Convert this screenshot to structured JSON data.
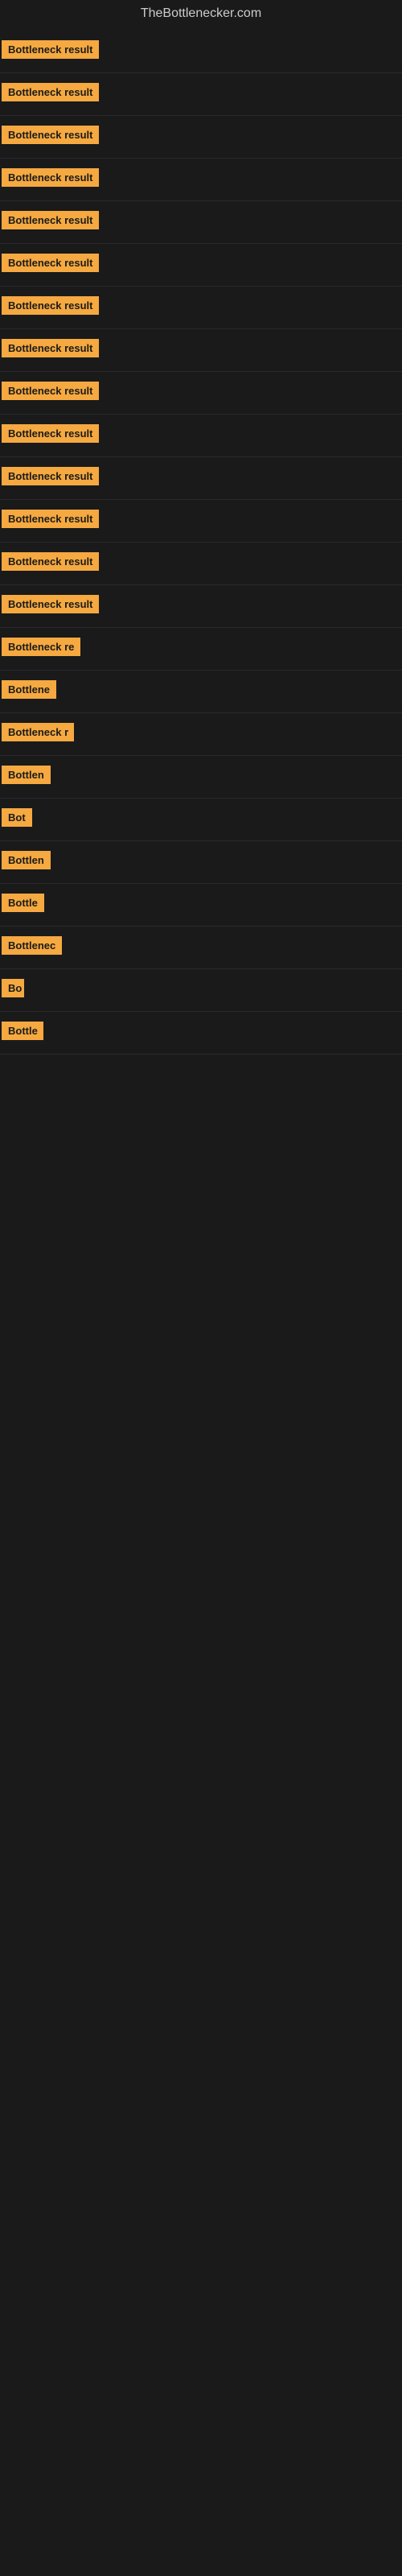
{
  "site": {
    "title": "TheBottlenecker.com"
  },
  "rows": [
    {
      "label": "Bottleneck result",
      "width": 130
    },
    {
      "label": "Bottleneck result",
      "width": 130
    },
    {
      "label": "Bottleneck result",
      "width": 130
    },
    {
      "label": "Bottleneck result",
      "width": 130
    },
    {
      "label": "Bottleneck result",
      "width": 130
    },
    {
      "label": "Bottleneck result",
      "width": 130
    },
    {
      "label": "Bottleneck result",
      "width": 130
    },
    {
      "label": "Bottleneck result",
      "width": 130
    },
    {
      "label": "Bottleneck result",
      "width": 130
    },
    {
      "label": "Bottleneck result",
      "width": 130
    },
    {
      "label": "Bottleneck result",
      "width": 130
    },
    {
      "label": "Bottleneck result",
      "width": 130
    },
    {
      "label": "Bottleneck result",
      "width": 130
    },
    {
      "label": "Bottleneck result",
      "width": 130
    },
    {
      "label": "Bottleneck re",
      "width": 100
    },
    {
      "label": "Bottlene",
      "width": 75
    },
    {
      "label": "Bottleneck r",
      "width": 90
    },
    {
      "label": "Bottlen",
      "width": 68
    },
    {
      "label": "Bot",
      "width": 38
    },
    {
      "label": "Bottlen",
      "width": 65
    },
    {
      "label": "Bottle",
      "width": 55
    },
    {
      "label": "Bottlenec",
      "width": 82
    },
    {
      "label": "Bo",
      "width": 28
    },
    {
      "label": "Bottle",
      "width": 52
    }
  ]
}
